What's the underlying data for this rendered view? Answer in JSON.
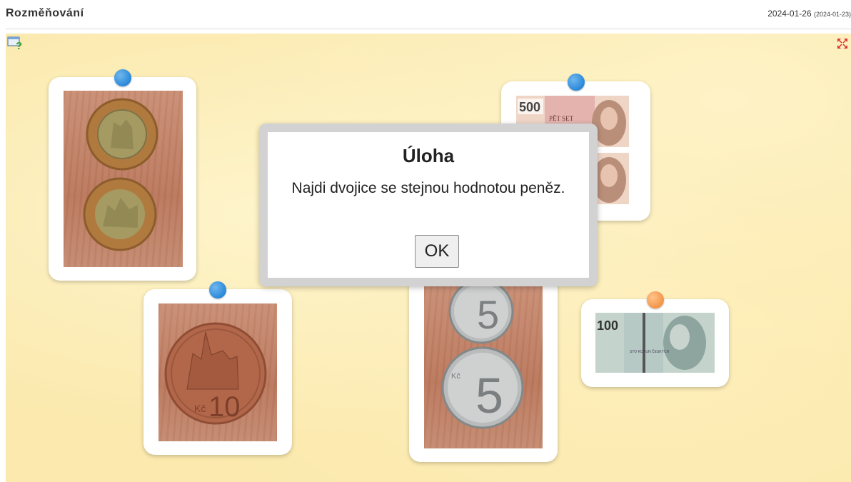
{
  "header": {
    "title": "Rozměňování",
    "date": "2024-01-26",
    "date_sub": "(2024-01-23)"
  },
  "board": {
    "help_icon": "help-icon",
    "fullscreen_icon": "fullscreen-icon"
  },
  "cards": [
    {
      "id": "two-50-kc-coins",
      "pin": "blue",
      "content": "two 50 Kč coins"
    },
    {
      "id": "500-kc-banknotes",
      "pin": "blue",
      "content": "two 500 Kč banknotes",
      "note_value": "500",
      "note_words": "PĚT SET"
    },
    {
      "id": "10-kc-coin",
      "pin": "blue",
      "content": "10 Kč coin",
      "coin_value": "10",
      "coin_currency": "Kč"
    },
    {
      "id": "two-5-kc-coins",
      "pin": "blue",
      "content": "two 5 Kč coins",
      "coin_value": "5",
      "coin_currency": "Kč"
    },
    {
      "id": "100-kc-banknote",
      "pin": "orange",
      "content": "100 Kč banknote",
      "note_value": "100",
      "note_words": "STO KORUN ČESKÝCH"
    }
  ],
  "dialog": {
    "title": "Úloha",
    "message": "Najdi dvojice se stejnou hodnotou peněz.",
    "ok_label": "OK"
  },
  "colors": {
    "board_bg": "#fbe9ad",
    "pin_blue": "#2a88d8",
    "pin_orange": "#f39448"
  }
}
